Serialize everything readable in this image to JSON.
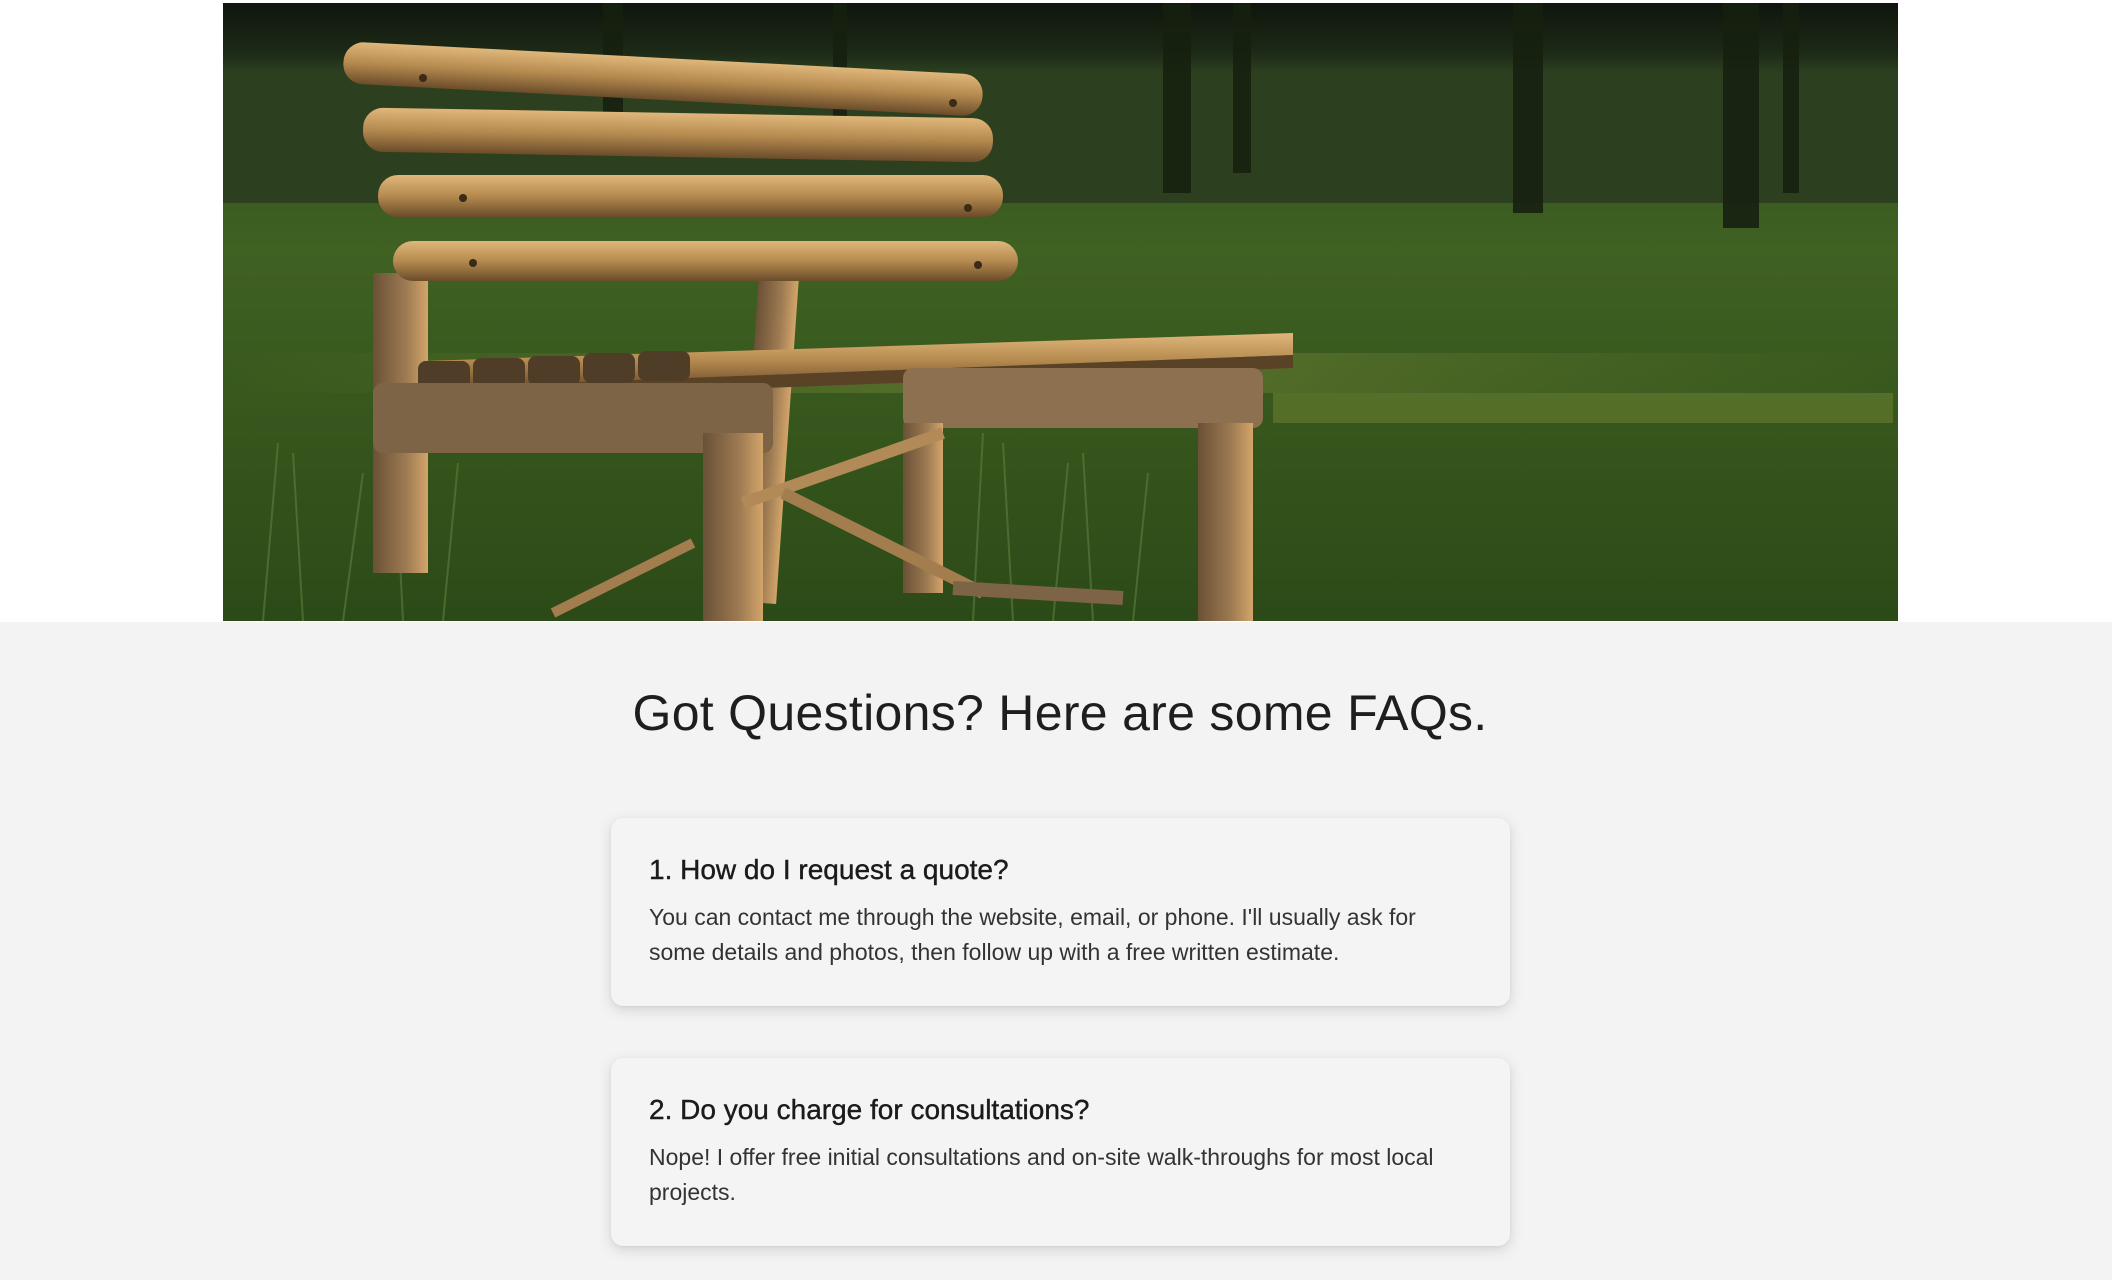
{
  "hero": {
    "image_description_icon": "park-bench-photo"
  },
  "faq": {
    "title": "Got Questions? Here are some FAQs.",
    "items": [
      {
        "question": "1. How do I request a quote?",
        "answer": "You can contact me through the website, email, or phone. I'll usually ask for some details and photos, then follow up with a free written estimate."
      },
      {
        "question": "2. Do you charge for consultations?",
        "answer": "Nope! I offer free initial consultations and on-site walk-throughs for most local projects."
      }
    ]
  },
  "colors": {
    "page_background": "#f3f3f3",
    "card_background": "#f4f4f4",
    "text_primary": "#1e1e1e"
  }
}
